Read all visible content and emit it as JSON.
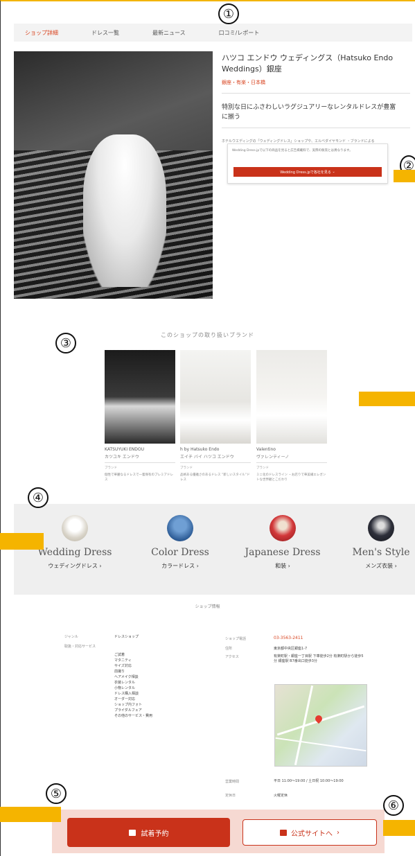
{
  "annotations": [
    "①",
    "②",
    "③",
    "④",
    "⑤",
    "⑥"
  ],
  "nav": {
    "tabs": [
      "ショップ詳細",
      "ドレス一覧",
      "最新ニュース",
      "口コミ/レポート"
    ]
  },
  "shop": {
    "title": "ハツコ エンドウ ウェディングス（Hatsuko Endo Weddings）銀座",
    "area": "銀座・有楽・日本橋",
    "catch": "特別な日にふさわしいラグジュアリーなレンタルドレスが豊富に揃う",
    "desc": "ホテルウエディングの「ウェディングドレス」ショップや、エルベダイヤモンド ・ブランドによる",
    "popup_text": "Wedding Dress.jpで以下の商品を見ると広告掲載料で、実際の販売とは異なります。",
    "popup_button": "Wedding Dress.jpで各社を見る"
  },
  "brands_title": "このショップの取り扱いブランド",
  "brands": [
    {
      "name": "KATSUYUKI ENDOU",
      "kana": "カツユキ エンドウ",
      "small": "ブランド",
      "desc": "個性で華麗なるドレスで一着保有のプレミアドレス"
    },
    {
      "name": "h by Hatsuko Endo",
      "kana": "エイチ バイ ハツコ エンドウ",
      "small": "ブランド",
      "desc": "品格ある優雅さのあるドレス ”新しいスタイル”ドレス"
    },
    {
      "name": "Valentino",
      "kana": "ヴァレンティーノ",
      "small": "ブランド",
      "desc": "ミニ化のドレスライン ・お店りで華美繊エレガントな世界観とこだわり"
    }
  ],
  "categories": [
    {
      "en": "Wedding Dress",
      "ja": "ウェディングドレス ›"
    },
    {
      "en": "Color Dress",
      "ja": "カラードレス ›"
    },
    {
      "en": "Japanese Dress",
      "ja": "和装 ›"
    },
    {
      "en": "Men's Style",
      "ja": "メンズ衣装 ›"
    }
  ],
  "info": {
    "title": "ショップ情報",
    "genre_label": "ジャンル",
    "genre_value": "ドレスショップ",
    "services_label": "取扱・対応サービス",
    "services": [
      "ご試着",
      "マタニティ",
      "サイズ対応",
      "前撮り",
      "ヘアメイク相談",
      "衣装レンタル",
      "小物レンタル",
      "ドレス購入相談",
      "オーダー対応",
      "ショップ内フォト",
      "プライダルフェア",
      "その他のサービス・費用"
    ],
    "tel_label": "ショップ電話",
    "tel": "03-3563-2411",
    "address_label": "住所",
    "address_value": "東京都中央区銀座1-7",
    "access_label": "アクセス",
    "access_value": "有楽町駅・銀座一丁目駅 下車徒歩2分 有楽町駅から徒歩5分 銀座駅 B7番出口徒歩3分",
    "hours_label": "営業時間",
    "hours_value": "平日 11:00〜19:00 / 土日祝 10:00〜19:00",
    "closed_label": "定休日",
    "closed_value": "火曜定休"
  },
  "cta": {
    "reserve": "試着予約",
    "site": "公式サイトへ"
  },
  "colors": {
    "accent": "#c9321a",
    "marker": "#f5b400"
  }
}
